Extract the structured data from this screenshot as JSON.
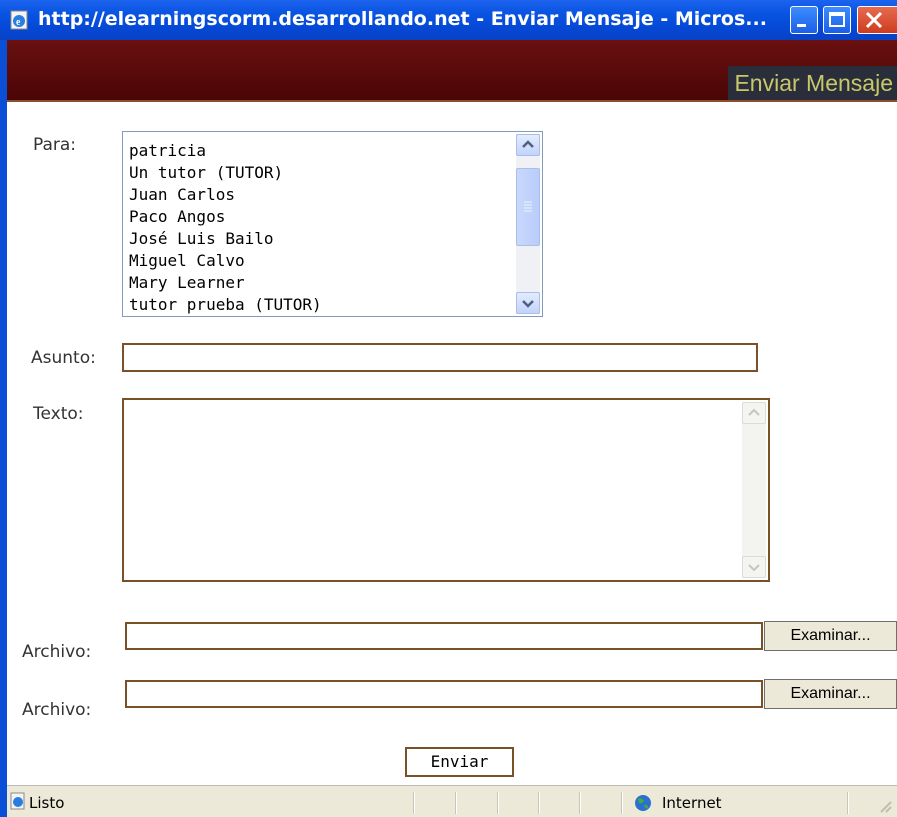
{
  "window": {
    "title": "http://elearningscorm.desarrollando.net - Enviar Mensaje - Micros...",
    "controls": {
      "minimize_icon": "minimize-icon",
      "maximize_icon": "maximize-icon",
      "close_icon": "close-icon"
    },
    "title_bar_color": "#0a55e3"
  },
  "header": {
    "title": "Enviar Mensaje",
    "band_color": "#5a0808",
    "title_color": "#c8c86a"
  },
  "form": {
    "para_label": "Para:",
    "recipients": [
      "patricia",
      "Un tutor (TUTOR)",
      "Juan Carlos",
      "Paco Angos",
      "José Luis Bailo",
      "Miguel Calvo",
      "Mary Learner",
      "tutor prueba (TUTOR)"
    ],
    "asunto_label": "Asunto:",
    "asunto_value": "",
    "texto_label": "Texto:",
    "texto_value": "",
    "archivo_label_1": "Archivo:",
    "archivo_value_1": "",
    "examinar_label_1": "Examinar...",
    "archivo_label_2": "Archivo:",
    "archivo_value_2": "",
    "examinar_label_2": "Examinar...",
    "submit_label": "Enviar"
  },
  "statusbar": {
    "status": "Listo",
    "zone": "Internet",
    "zone_icon": "globe-icon",
    "page_icon": "ie-page-icon"
  }
}
